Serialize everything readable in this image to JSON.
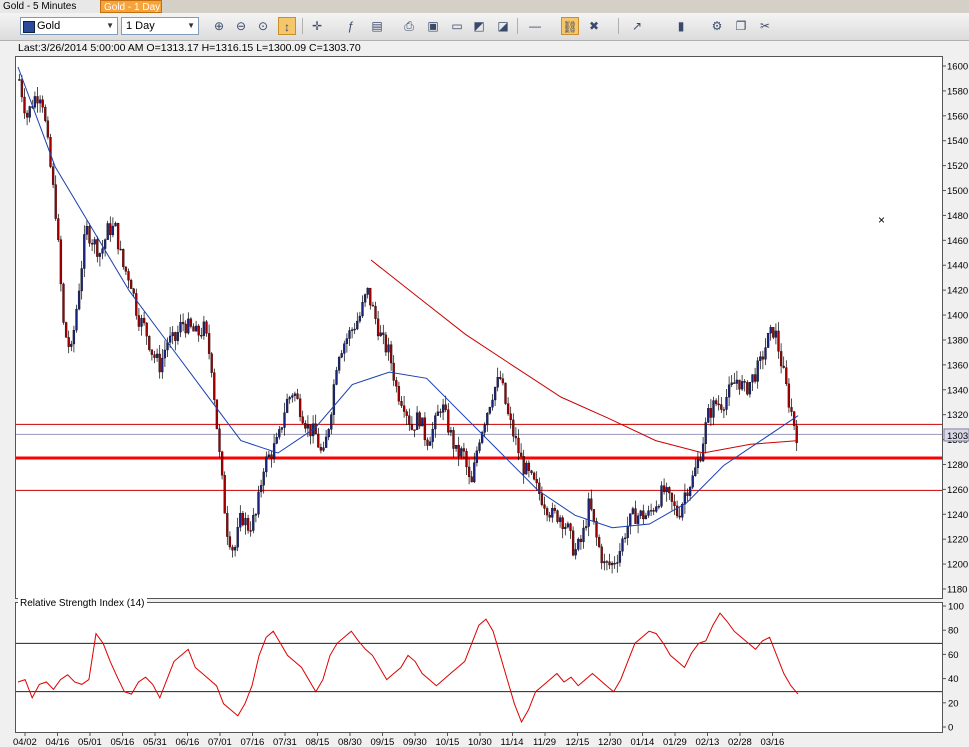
{
  "tabs": [
    {
      "label": "Gold - 5 Minutes",
      "active": false
    },
    {
      "label": "Gold - 1 Day",
      "active": true
    }
  ],
  "toolbar": {
    "symbol": "Gold",
    "timeframe": "1 Day",
    "icons": [
      "zoom-in-icon",
      "zoom-out-icon",
      "zoom-fit-icon",
      "cursor-icon",
      "crosshair-icon",
      "indicator-icon",
      "chart-properties-icon",
      "print-icon",
      "save-icon",
      "document-icon",
      "export-icon",
      "save-image-icon",
      "line-style-icon",
      "link-icon",
      "delete-icon",
      "trend-tool-icon",
      "candle-type-icon",
      "settings-icon",
      "copy-icon",
      "tools-icon"
    ]
  },
  "info": {
    "text": "Last:3/26/2014 5:00:00 AM O=1313.17 H=1316.15 L=1300.09 C=1303.70"
  },
  "rsi": {
    "title": "Relative Strength Index (14)"
  },
  "chart_data": [
    {
      "type": "candlestick",
      "title": "",
      "ylim": [
        1180,
        1600
      ],
      "y_ticks": [
        "1600",
        "1580",
        "1560",
        "1540",
        "1520",
        "1500",
        "1480",
        "1460",
        "1440",
        "1420",
        "1400",
        "1380",
        "1360",
        "1340",
        "1320",
        "1300",
        "1280",
        "1260",
        "1240",
        "1220",
        "1200",
        "1180"
      ],
      "x_ticks": [
        "04/02",
        "04/16",
        "05/01",
        "05/16",
        "05/31",
        "06/16",
        "07/01",
        "07/16",
        "07/31",
        "08/15",
        "08/30",
        "09/15",
        "09/30",
        "10/15",
        "10/30",
        "11/14",
        "11/29",
        "12/15",
        "12/30",
        "01/14",
        "01/29",
        "02/13",
        "02/28",
        "03/16"
      ],
      "last_price_label": "1303",
      "close_path": [
        1590,
        1560,
        1575,
        1580,
        1530,
        1480,
        1390,
        1370,
        1420,
        1470,
        1460,
        1450,
        1470,
        1470,
        1440,
        1430,
        1400,
        1390,
        1370,
        1360,
        1380,
        1380,
        1395,
        1390,
        1385,
        1390,
        1360,
        1290,
        1230,
        1210,
        1240,
        1230,
        1240,
        1280,
        1290,
        1300,
        1330,
        1340,
        1325,
        1310,
        1305,
        1285,
        1320,
        1370,
        1380,
        1390,
        1400,
        1420,
        1400,
        1380,
        1370,
        1340,
        1330,
        1310,
        1320,
        1300,
        1310,
        1330,
        1310,
        1290,
        1290,
        1260,
        1300,
        1320,
        1340,
        1350,
        1320,
        1300,
        1280,
        1270,
        1260,
        1250,
        1240,
        1240,
        1230,
        1210,
        1220,
        1250,
        1220,
        1200,
        1200,
        1210,
        1230,
        1240,
        1240,
        1240,
        1250,
        1260,
        1250,
        1240,
        1260,
        1270,
        1290,
        1320,
        1330,
        1330,
        1340,
        1350,
        1340,
        1350,
        1360,
        1380,
        1390,
        1360,
        1330,
        1305
      ],
      "sma_blue": [
        1600,
        1520,
        1470,
        1420,
        1380,
        1340,
        1300,
        1290,
        1310,
        1345,
        1355,
        1350,
        1320,
        1290,
        1260,
        1240,
        1230,
        1233,
        1250,
        1280,
        1300,
        1320
      ],
      "sma_red": [
        1445,
        1415,
        1385,
        1360,
        1335,
        1318,
        1300,
        1290,
        1297,
        1300
      ],
      "horizontal_levels": [
        {
          "value": 1313,
          "color": "#cc0000",
          "weight": 1
        },
        {
          "value": 1305,
          "color": "#9999bb",
          "weight": 1
        },
        {
          "value": 1286,
          "color": "#ff0000",
          "weight": 3
        },
        {
          "value": 1260,
          "color": "#cc0000",
          "weight": 1
        }
      ]
    },
    {
      "type": "line",
      "title": "Relative Strength Index (14)",
      "ylim": [
        0,
        100
      ],
      "y_ticks": [
        "100",
        "80",
        "60",
        "40",
        "20",
        "0"
      ],
      "levels": [
        70,
        30
      ],
      "series": [
        {
          "values": [
            38,
            40,
            25,
            36,
            38,
            32,
            40,
            44,
            38,
            36,
            40,
            78,
            70,
            55,
            42,
            30,
            28,
            38,
            42,
            36,
            25,
            40,
            55,
            60,
            65,
            50,
            45,
            40,
            35,
            20,
            15,
            10,
            20,
            35,
            60,
            75,
            80,
            70,
            60,
            55,
            50,
            40,
            30,
            40,
            60,
            70,
            75,
            80,
            72,
            65,
            60,
            50,
            40,
            45,
            50,
            60,
            55,
            45,
            40,
            35,
            40,
            45,
            50,
            55,
            70,
            85,
            90,
            80,
            60,
            40,
            20,
            5,
            15,
            30,
            35,
            40,
            45,
            38,
            42,
            35,
            40,
            45,
            40,
            35,
            30,
            40,
            55,
            70,
            75,
            80,
            78,
            70,
            60,
            55,
            50,
            62,
            70,
            72,
            85,
            95,
            88,
            80,
            75,
            70,
            65,
            72,
            75,
            60,
            45,
            35,
            28
          ]
        }
      ]
    }
  ],
  "colors": {
    "candle_up": "#1a237e",
    "candle_down": "#a00000",
    "sma_blue": "#1a3fb0",
    "sma_red": "#cc0000",
    "rsi_line": "#dd0000",
    "tab_active": "#f7a23a"
  }
}
